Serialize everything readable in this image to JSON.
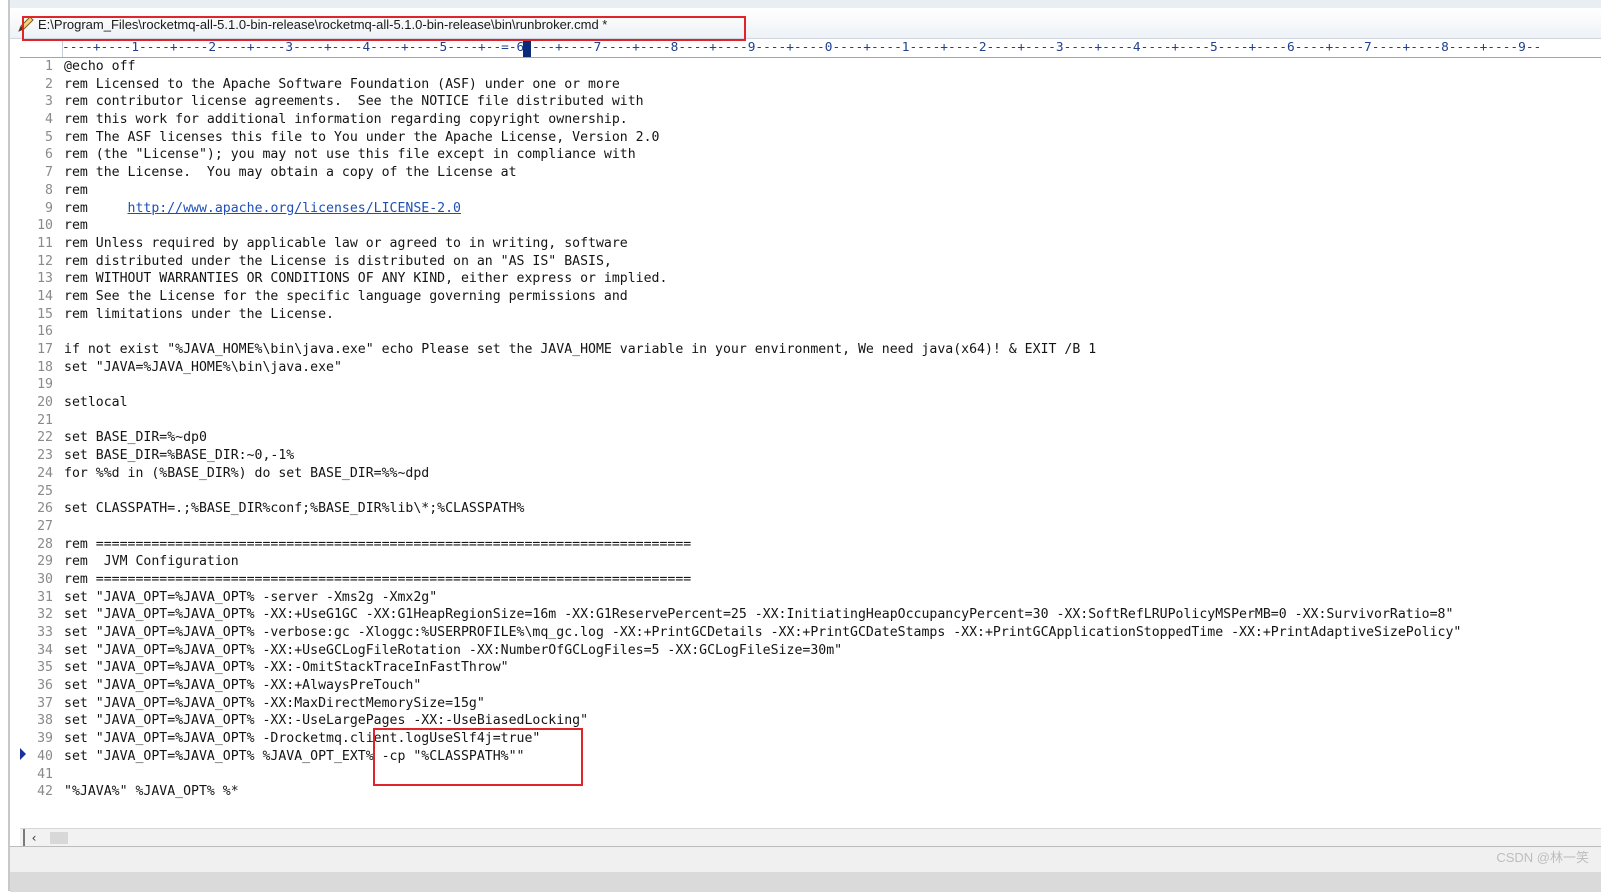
{
  "window": {
    "title": "E:\\Program_Files\\rocketmq-all-5.1.0-bin-release\\rocketmq-all-5.1.0-bin-release\\bin\\runbroker.cmd *"
  },
  "ruler": {
    "text": "----+----1----+----2----+----3----+----4----+----5----+--=-6----+----7----+----8----+----9----+----0----+----1----+----2----+----3----+----4----+----5----+----6----+----7----+----8----+----9--"
  },
  "editor": {
    "line_numbers": [
      "1",
      "2",
      "3",
      "4",
      "5",
      "6",
      "7",
      "8",
      "9",
      "10",
      "11",
      "12",
      "13",
      "14",
      "15",
      "16",
      "17",
      "18",
      "19",
      "20",
      "21",
      "22",
      "23",
      "24",
      "25",
      "26",
      "27",
      "28",
      "29",
      "30",
      "31",
      "32",
      "33",
      "34",
      "35",
      "36",
      "37",
      "38",
      "39",
      "40",
      "41",
      "42"
    ],
    "lines": [
      "@echo off",
      "rem Licensed to the Apache Software Foundation (ASF) under one or more",
      "rem contributor license agreements.  See the NOTICE file distributed with",
      "rem this work for additional information regarding copyright ownership.",
      "rem The ASF licenses this file to You under the Apache License, Version 2.0",
      "rem (the \"License\"); you may not use this file except in compliance with",
      "rem the License.  You may obtain a copy of the License at",
      "rem",
      "rem     ",
      "rem",
      "rem Unless required by applicable law or agreed to in writing, software",
      "rem distributed under the License is distributed on an \"AS IS\" BASIS,",
      "rem WITHOUT WARRANTIES OR CONDITIONS OF ANY KIND, either express or implied.",
      "rem See the License for the specific language governing permissions and",
      "rem limitations under the License.",
      "",
      "if not exist \"%JAVA_HOME%\\bin\\java.exe\" echo Please set the JAVA_HOME variable in your environment, We need java(x64)! & EXIT /B 1",
      "set \"JAVA=%JAVA_HOME%\\bin\\java.exe\"",
      "",
      "setlocal",
      "",
      "set BASE_DIR=%~dp0",
      "set BASE_DIR=%BASE_DIR:~0,-1%",
      "for %%d in (%BASE_DIR%) do set BASE_DIR=%%~dpd",
      "",
      "set CLASSPATH=.;%BASE_DIR%conf;%BASE_DIR%lib\\*;%CLASSPATH%",
      "",
      "rem ===========================================================================",
      "rem  JVM Configuration",
      "rem ===========================================================================",
      "set \"JAVA_OPT=%JAVA_OPT% -server -Xms2g -Xmx2g\"",
      "set \"JAVA_OPT=%JAVA_OPT% -XX:+UseG1GC -XX:G1HeapRegionSize=16m -XX:G1ReservePercent=25 -XX:InitiatingHeapOccupancyPercent=30 -XX:SoftRefLRUPolicyMSPerMB=0 -XX:SurvivorRatio=8\"",
      "set \"JAVA_OPT=%JAVA_OPT% -verbose:gc -Xloggc:%USERPROFILE%\\mq_gc.log -XX:+PrintGCDetails -XX:+PrintGCDateStamps -XX:+PrintGCApplicationStoppedTime -XX:+PrintAdaptiveSizePolicy\"",
      "set \"JAVA_OPT=%JAVA_OPT% -XX:+UseGCLogFileRotation -XX:NumberOfGCLogFiles=5 -XX:GCLogFileSize=30m\"",
      "set \"JAVA_OPT=%JAVA_OPT% -XX:-OmitStackTraceInFastThrow\"",
      "set \"JAVA_OPT=%JAVA_OPT% -XX:+AlwaysPreTouch\"",
      "set \"JAVA_OPT=%JAVA_OPT% -XX:MaxDirectMemorySize=15g\"",
      "set \"JAVA_OPT=%JAVA_OPT% -XX:-UseLargePages -XX:-UseBiasedLocking\"",
      "set \"JAVA_OPT=%JAVA_OPT% -Drocketmq.client.logUseSlf4j=true\"",
      "set \"JAVA_OPT=%JAVA_OPT% %JAVA_OPT_EXT% -cp \"%CLASSPATH%\"\"",
      "",
      "\"%JAVA%\" %JAVA_OPT% %*"
    ],
    "link_text": "http://www.apache.org/licenses/LICENSE-2.0"
  },
  "watermark": "CSDN @林一笑",
  "colors": {
    "highlight": "#e0242b",
    "link": "#1f4fb5",
    "line_number": "#8a8a8a"
  }
}
